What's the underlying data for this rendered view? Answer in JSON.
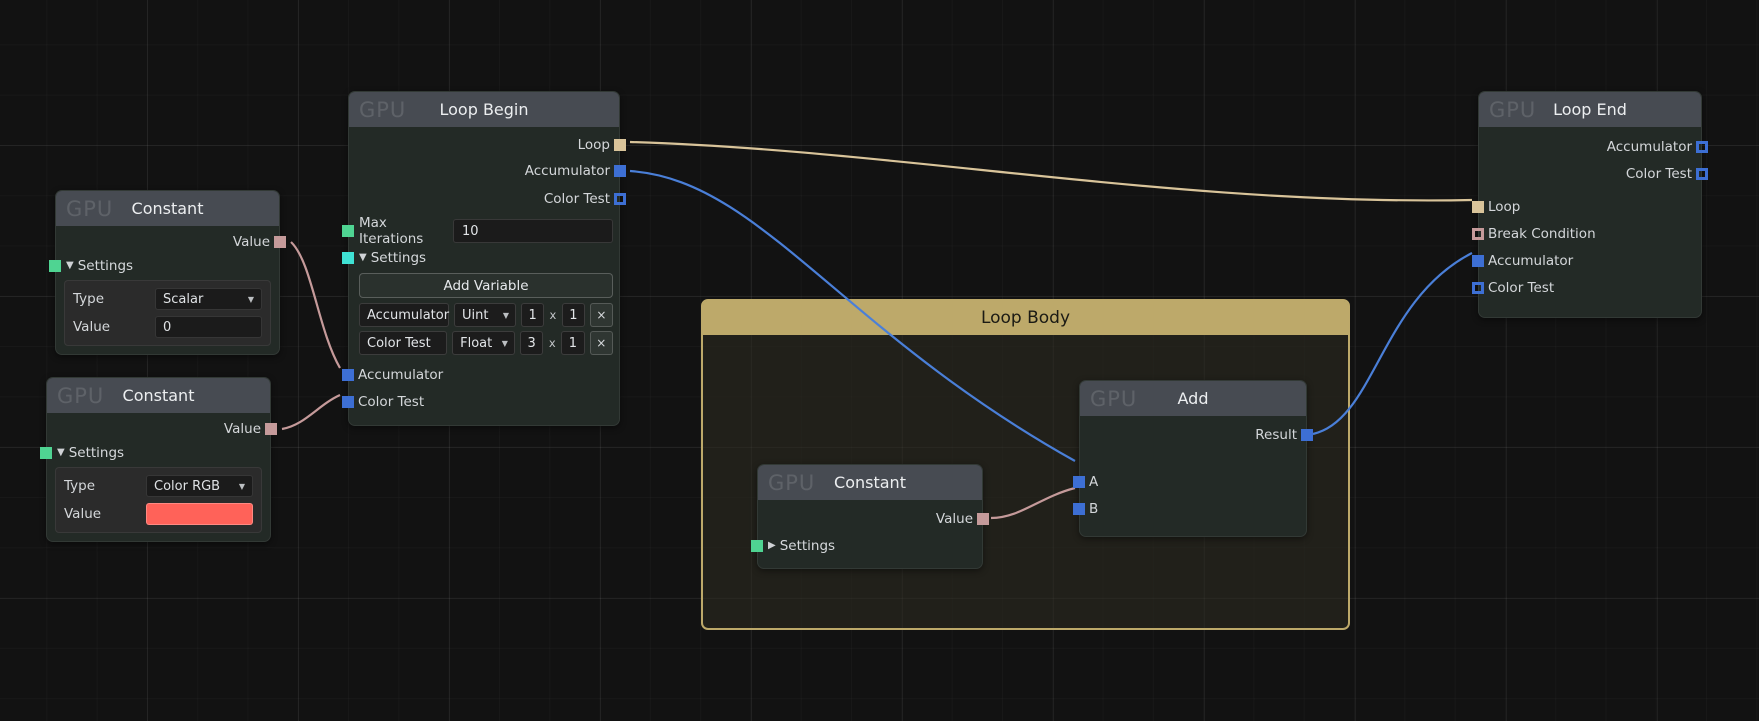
{
  "canvas": {
    "background": "#121212",
    "grid": "on"
  },
  "groups": [
    {
      "title": "Loop Body",
      "border_color": "#bda96a"
    }
  ],
  "nodes": {
    "constant_scalar": {
      "badge": "GPU",
      "title": "Constant",
      "outputs": [
        {
          "label": "Value",
          "port": "square-pink-filled"
        }
      ],
      "settings": {
        "label": "Settings",
        "expanded": true,
        "toggle_icon": "triangle-down-icon",
        "port": "square-green-filled",
        "fields": [
          {
            "label": "Type",
            "value": "Scalar",
            "control": "dropdown"
          },
          {
            "label": "Value",
            "value": "0",
            "control": "text"
          }
        ]
      }
    },
    "constant_color": {
      "badge": "GPU",
      "title": "Constant",
      "outputs": [
        {
          "label": "Value",
          "port": "square-pink-filled"
        }
      ],
      "settings": {
        "label": "Settings",
        "expanded": true,
        "toggle_icon": "triangle-down-icon",
        "port": "square-green-filled",
        "fields": [
          {
            "label": "Type",
            "value": "Color RGB",
            "control": "dropdown"
          },
          {
            "label": "Value",
            "value": "#FF6259",
            "control": "color-swatch"
          }
        ]
      }
    },
    "loop_begin": {
      "badge": "GPU",
      "title": "Loop Begin",
      "outputs": [
        {
          "label": "Loop",
          "port": "square-tan-filled"
        },
        {
          "label": "Accumulator",
          "port": "square-blue-filled"
        },
        {
          "label": "Color Test",
          "port": "square-blue-hollow"
        }
      ],
      "max_iterations": {
        "label": "Max Iterations",
        "value": "10",
        "port": "square-green-filled"
      },
      "settings": {
        "label": "Settings",
        "expanded": true,
        "toggle_icon": "triangle-down-icon",
        "port": "square-cyan-filled",
        "add_variable_label": "Add Variable",
        "variables": [
          {
            "name": "Accumulator",
            "type": "Uint",
            "rows": "1",
            "cols": "1",
            "delete_label": "×"
          },
          {
            "name": "Color Test",
            "type": "Float",
            "rows": "3",
            "cols": "1",
            "delete_label": "×"
          }
        ]
      },
      "inputs": [
        {
          "label": "Accumulator",
          "port": "square-blue-filled"
        },
        {
          "label": "Color Test",
          "port": "square-blue-filled"
        }
      ]
    },
    "loop_body_constant": {
      "badge": "GPU",
      "title": "Constant",
      "outputs": [
        {
          "label": "Value",
          "port": "square-pink-filled"
        }
      ],
      "settings": {
        "label": "Settings",
        "expanded": false,
        "toggle_icon": "triangle-right-icon",
        "port": "square-green-filled"
      }
    },
    "add": {
      "badge": "GPU",
      "title": "Add",
      "outputs": [
        {
          "label": "Result",
          "port": "square-blue-filled"
        }
      ],
      "inputs": [
        {
          "label": "A",
          "port": "square-blue-filled"
        },
        {
          "label": "B",
          "port": "square-blue-filled"
        }
      ]
    },
    "loop_end": {
      "badge": "GPU",
      "title": "Loop End",
      "outputs": [
        {
          "label": "Accumulator",
          "port": "square-blue-hollow"
        },
        {
          "label": "Color Test",
          "port": "square-blue-hollow"
        }
      ],
      "inputs": [
        {
          "label": "Loop",
          "port": "square-tan-filled"
        },
        {
          "label": "Break Condition",
          "port": "square-pink-hollow"
        },
        {
          "label": "Accumulator",
          "port": "square-blue-filled"
        },
        {
          "label": "Color Test",
          "port": "square-blue-hollow"
        }
      ]
    }
  },
  "wire_colors": {
    "loop": "#d9c49a",
    "data_blue": "#4a7fd8",
    "data_pink": "#c59a9a"
  }
}
